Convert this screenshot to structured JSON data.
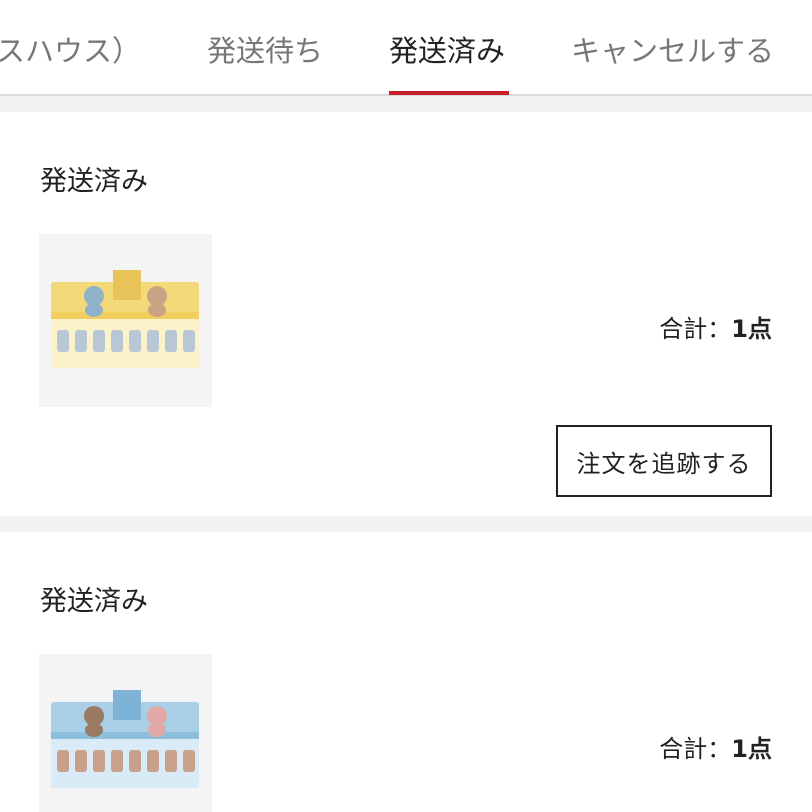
{
  "tabs": [
    {
      "label": "スハウス）",
      "active": false
    },
    {
      "label": "発送待ち",
      "active": false
    },
    {
      "label": "発送済み",
      "active": true
    },
    {
      "label": "キャンセルする",
      "active": false
    }
  ],
  "orders": [
    {
      "status": "発送済み",
      "total_label": "合計：",
      "total_count": "1点",
      "track_button": "注文を追跡する",
      "image_icon": "product-box-yellow",
      "accent_color": "#f3d97a"
    },
    {
      "status": "発送済み",
      "total_label": "合計：",
      "total_count": "1点",
      "image_icon": "product-box-blue",
      "accent_color": "#a9cfe6"
    }
  ],
  "colors": {
    "active_tab_underline": "#c8202b",
    "background": "#f2f2f2",
    "card": "#ffffff"
  }
}
